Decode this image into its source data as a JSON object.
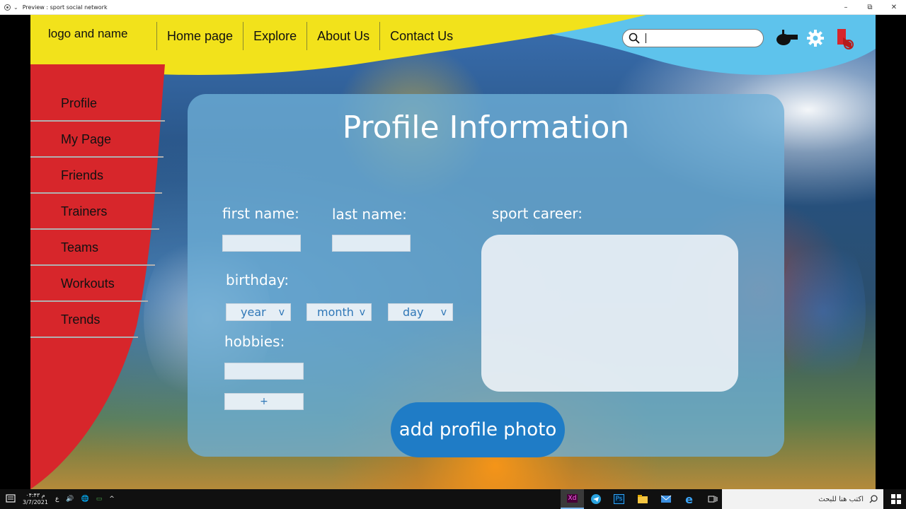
{
  "window": {
    "title": "Preview : sport social network",
    "minimize": "–",
    "restore": "⧉",
    "close": "✕"
  },
  "header": {
    "logo": "logo and name",
    "nav": [
      "Home page",
      "Explore",
      "About Us",
      "Contact Us"
    ],
    "search": {
      "value": ""
    },
    "icons": [
      "whistle-icon",
      "gear-icon",
      "logout-icon"
    ]
  },
  "sidebar": {
    "items": [
      "Profile",
      "My Page",
      "Friends",
      "Trainers",
      "Teams",
      "Workouts",
      "Trends"
    ]
  },
  "profile": {
    "title": "Profile Information",
    "first_name_label": "first name:",
    "last_name_label": "last name:",
    "sport_career_label": "sport career:",
    "birthday_label": "birthday:",
    "year": "year",
    "month": "month",
    "day": "day",
    "caret": "v",
    "hobbies_label": "hobbies:",
    "add_hobby": "+",
    "add_photo": "add profile photo"
  },
  "taskbar": {
    "time": "۰۴:۴۳ م",
    "date": "3/7/2021",
    "lang": "ع",
    "search_placeholder": "اكتب هنا للبحث",
    "apps": [
      "Xd",
      "telegram-icon",
      "Ps",
      "file-explorer-icon",
      "mail-icon",
      "edge-icon",
      "task-view-icon"
    ]
  },
  "colors": {
    "yellow": "#f2e21b",
    "blue": "#5ec3ec",
    "sidebar_red": "#d7262b",
    "button_blue": "#1f7cc6"
  }
}
